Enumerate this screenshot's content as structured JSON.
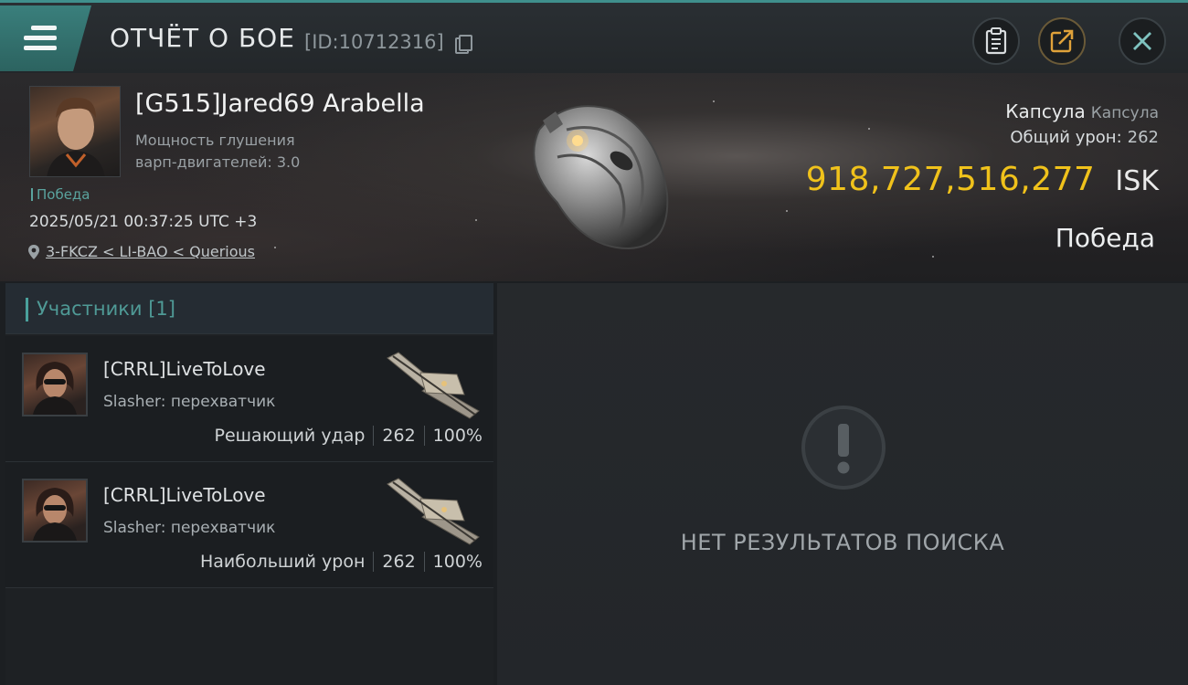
{
  "header": {
    "title": "ОТЧЁТ О БОЕ",
    "id_label": "[ID:10712316]",
    "icons": [
      "menu-icon",
      "copy-icon",
      "clipboard-icon",
      "export-icon",
      "close-icon"
    ]
  },
  "victim": {
    "name": "[G515]Jared69 Arabella",
    "stat_line1": "Мощность глушения",
    "stat_line2": "варп-двигателей: 3.0",
    "tag": "Победа",
    "datetime": "2025/05/21 00:37:25 UTC +3",
    "location": "3-FKCZ < LI-BAO < Querious"
  },
  "summary": {
    "ship_name": "Капсула",
    "ship_class": "Капсула",
    "damage_label": "Общий урон:",
    "damage_value": "262",
    "isk_value": "918,727,516,277",
    "isk_unit": "ISK",
    "result": "Победа"
  },
  "participants": {
    "header": "Участники [1]",
    "rows": [
      {
        "name": "[CRRL]LiveToLove",
        "ship": "Slasher: перехватчик",
        "role": "Решающий удар",
        "damage": "262",
        "percent": "100%"
      },
      {
        "name": "[CRRL]LiveToLove",
        "ship": "Slasher: перехватчик",
        "role": "Наибольший урон",
        "damage": "262",
        "percent": "100%"
      }
    ]
  },
  "empty_state": {
    "text": "НЕТ РЕЗУЛЬТАТОВ ПОИСКА"
  },
  "colors": {
    "accent": "#3f8f8c",
    "isk": "#f0c21b",
    "victory": "#5aa39e"
  }
}
